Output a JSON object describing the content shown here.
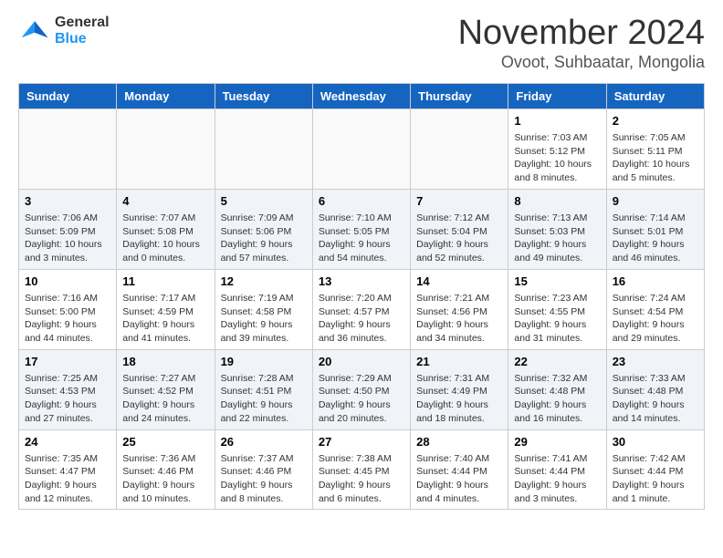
{
  "header": {
    "logo_line1": "General",
    "logo_line2": "Blue",
    "month": "November 2024",
    "location": "Ovoot, Suhbaatar, Mongolia"
  },
  "weekdays": [
    "Sunday",
    "Monday",
    "Tuesday",
    "Wednesday",
    "Thursday",
    "Friday",
    "Saturday"
  ],
  "weeks": [
    [
      {
        "day": "",
        "info": ""
      },
      {
        "day": "",
        "info": ""
      },
      {
        "day": "",
        "info": ""
      },
      {
        "day": "",
        "info": ""
      },
      {
        "day": "",
        "info": ""
      },
      {
        "day": "1",
        "info": "Sunrise: 7:03 AM\nSunset: 5:12 PM\nDaylight: 10 hours and 8 minutes."
      },
      {
        "day": "2",
        "info": "Sunrise: 7:05 AM\nSunset: 5:11 PM\nDaylight: 10 hours and 5 minutes."
      }
    ],
    [
      {
        "day": "3",
        "info": "Sunrise: 7:06 AM\nSunset: 5:09 PM\nDaylight: 10 hours and 3 minutes."
      },
      {
        "day": "4",
        "info": "Sunrise: 7:07 AM\nSunset: 5:08 PM\nDaylight: 10 hours and 0 minutes."
      },
      {
        "day": "5",
        "info": "Sunrise: 7:09 AM\nSunset: 5:06 PM\nDaylight: 9 hours and 57 minutes."
      },
      {
        "day": "6",
        "info": "Sunrise: 7:10 AM\nSunset: 5:05 PM\nDaylight: 9 hours and 54 minutes."
      },
      {
        "day": "7",
        "info": "Sunrise: 7:12 AM\nSunset: 5:04 PM\nDaylight: 9 hours and 52 minutes."
      },
      {
        "day": "8",
        "info": "Sunrise: 7:13 AM\nSunset: 5:03 PM\nDaylight: 9 hours and 49 minutes."
      },
      {
        "day": "9",
        "info": "Sunrise: 7:14 AM\nSunset: 5:01 PM\nDaylight: 9 hours and 46 minutes."
      }
    ],
    [
      {
        "day": "10",
        "info": "Sunrise: 7:16 AM\nSunset: 5:00 PM\nDaylight: 9 hours and 44 minutes."
      },
      {
        "day": "11",
        "info": "Sunrise: 7:17 AM\nSunset: 4:59 PM\nDaylight: 9 hours and 41 minutes."
      },
      {
        "day": "12",
        "info": "Sunrise: 7:19 AM\nSunset: 4:58 PM\nDaylight: 9 hours and 39 minutes."
      },
      {
        "day": "13",
        "info": "Sunrise: 7:20 AM\nSunset: 4:57 PM\nDaylight: 9 hours and 36 minutes."
      },
      {
        "day": "14",
        "info": "Sunrise: 7:21 AM\nSunset: 4:56 PM\nDaylight: 9 hours and 34 minutes."
      },
      {
        "day": "15",
        "info": "Sunrise: 7:23 AM\nSunset: 4:55 PM\nDaylight: 9 hours and 31 minutes."
      },
      {
        "day": "16",
        "info": "Sunrise: 7:24 AM\nSunset: 4:54 PM\nDaylight: 9 hours and 29 minutes."
      }
    ],
    [
      {
        "day": "17",
        "info": "Sunrise: 7:25 AM\nSunset: 4:53 PM\nDaylight: 9 hours and 27 minutes."
      },
      {
        "day": "18",
        "info": "Sunrise: 7:27 AM\nSunset: 4:52 PM\nDaylight: 9 hours and 24 minutes."
      },
      {
        "day": "19",
        "info": "Sunrise: 7:28 AM\nSunset: 4:51 PM\nDaylight: 9 hours and 22 minutes."
      },
      {
        "day": "20",
        "info": "Sunrise: 7:29 AM\nSunset: 4:50 PM\nDaylight: 9 hours and 20 minutes."
      },
      {
        "day": "21",
        "info": "Sunrise: 7:31 AM\nSunset: 4:49 PM\nDaylight: 9 hours and 18 minutes."
      },
      {
        "day": "22",
        "info": "Sunrise: 7:32 AM\nSunset: 4:48 PM\nDaylight: 9 hours and 16 minutes."
      },
      {
        "day": "23",
        "info": "Sunrise: 7:33 AM\nSunset: 4:48 PM\nDaylight: 9 hours and 14 minutes."
      }
    ],
    [
      {
        "day": "24",
        "info": "Sunrise: 7:35 AM\nSunset: 4:47 PM\nDaylight: 9 hours and 12 minutes."
      },
      {
        "day": "25",
        "info": "Sunrise: 7:36 AM\nSunset: 4:46 PM\nDaylight: 9 hours and 10 minutes."
      },
      {
        "day": "26",
        "info": "Sunrise: 7:37 AM\nSunset: 4:46 PM\nDaylight: 9 hours and 8 minutes."
      },
      {
        "day": "27",
        "info": "Sunrise: 7:38 AM\nSunset: 4:45 PM\nDaylight: 9 hours and 6 minutes."
      },
      {
        "day": "28",
        "info": "Sunrise: 7:40 AM\nSunset: 4:44 PM\nDaylight: 9 hours and 4 minutes."
      },
      {
        "day": "29",
        "info": "Sunrise: 7:41 AM\nSunset: 4:44 PM\nDaylight: 9 hours and 3 minutes."
      },
      {
        "day": "30",
        "info": "Sunrise: 7:42 AM\nSunset: 4:44 PM\nDaylight: 9 hours and 1 minute."
      }
    ]
  ]
}
